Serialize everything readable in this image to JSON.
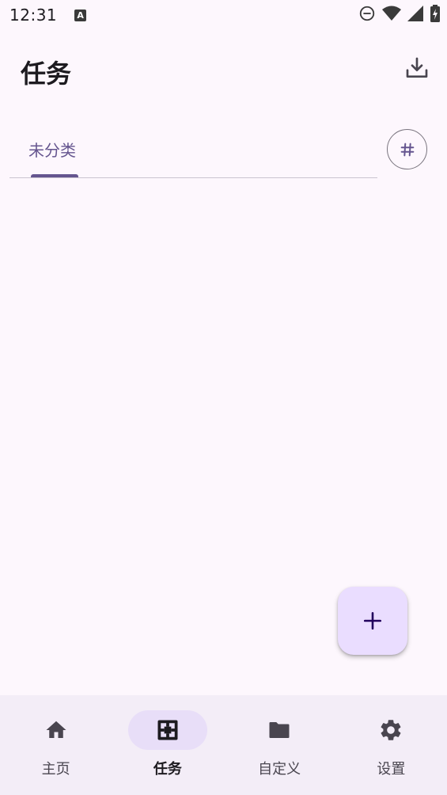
{
  "status_bar": {
    "time": "12:31",
    "app_icon_letter": "A",
    "icons": [
      "do-not-disturb-icon",
      "wifi-icon",
      "signal-icon",
      "battery-charging-icon"
    ]
  },
  "app_bar": {
    "title": "任务",
    "action_icon": "download-icon"
  },
  "tabs": [
    {
      "label": "未分类",
      "selected": true
    }
  ],
  "tag_button_icon": "hashtag-icon",
  "fab_icon": "add-icon",
  "bottom_nav": {
    "items": [
      {
        "label": "主页",
        "icon": "home-icon",
        "active": false
      },
      {
        "label": "任务",
        "icon": "task-icon",
        "active": true
      },
      {
        "label": "自定义",
        "icon": "folder-icon",
        "active": false
      },
      {
        "label": "设置",
        "icon": "gear-icon",
        "active": false
      }
    ]
  },
  "colors": {
    "background": "#fdf7fd",
    "primary": "#65558f",
    "fab_container": "#eaddff",
    "nav_background": "#f3edf7",
    "nav_active_indicator": "#e8def8"
  }
}
